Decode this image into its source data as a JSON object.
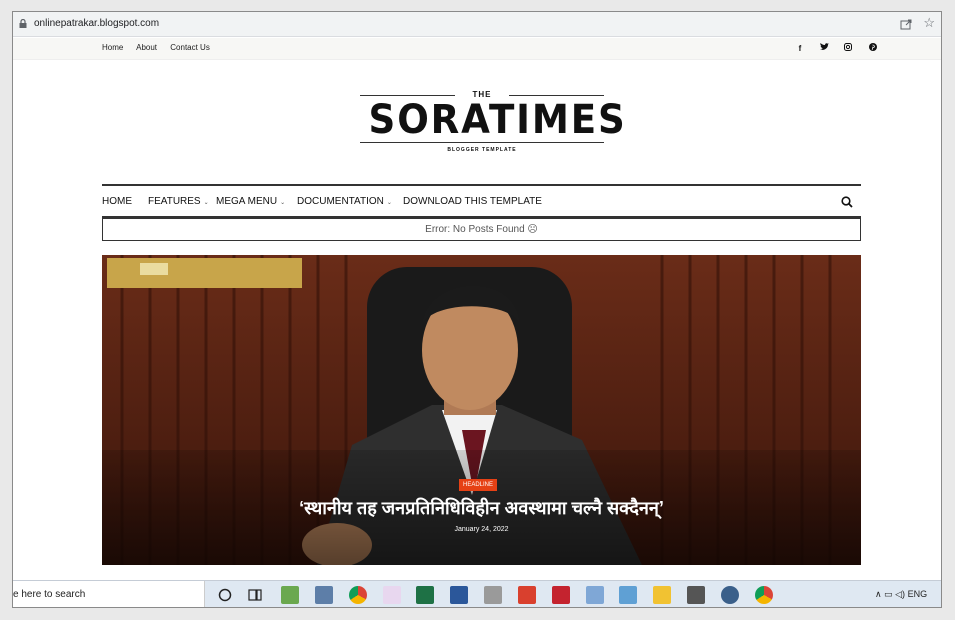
{
  "browser": {
    "url": "onlinepatrakar.blogspot.com"
  },
  "topnav": {
    "items": [
      "Home",
      "About",
      "Contact Us"
    ]
  },
  "social": [
    "f",
    "t",
    "ig",
    "p"
  ],
  "logo": {
    "the": "THE",
    "main": "SORATIMES",
    "sub": "BLOGGER TEMPLATE"
  },
  "mainnav": {
    "home": "HOME",
    "features": "FEATURES",
    "mega_menu": "MEGA MENU",
    "documentation": "DOCUMENTATION",
    "download": "DOWNLOAD THIS TEMPLATE"
  },
  "error": "Error: No Posts Found ☹",
  "hero": {
    "badge": "HEADLINE",
    "title": "‘स्थानीय तह जनप्रतिनिधिविहीन अवस्थामा चल्नै सक्दैनन्’",
    "date": "January 24, 2022"
  },
  "taskbar": {
    "search_placeholder": "e here to search",
    "lang": "ENG"
  },
  "colors": {
    "badge": "#e64115",
    "taskbar": "#dfe8f2"
  }
}
